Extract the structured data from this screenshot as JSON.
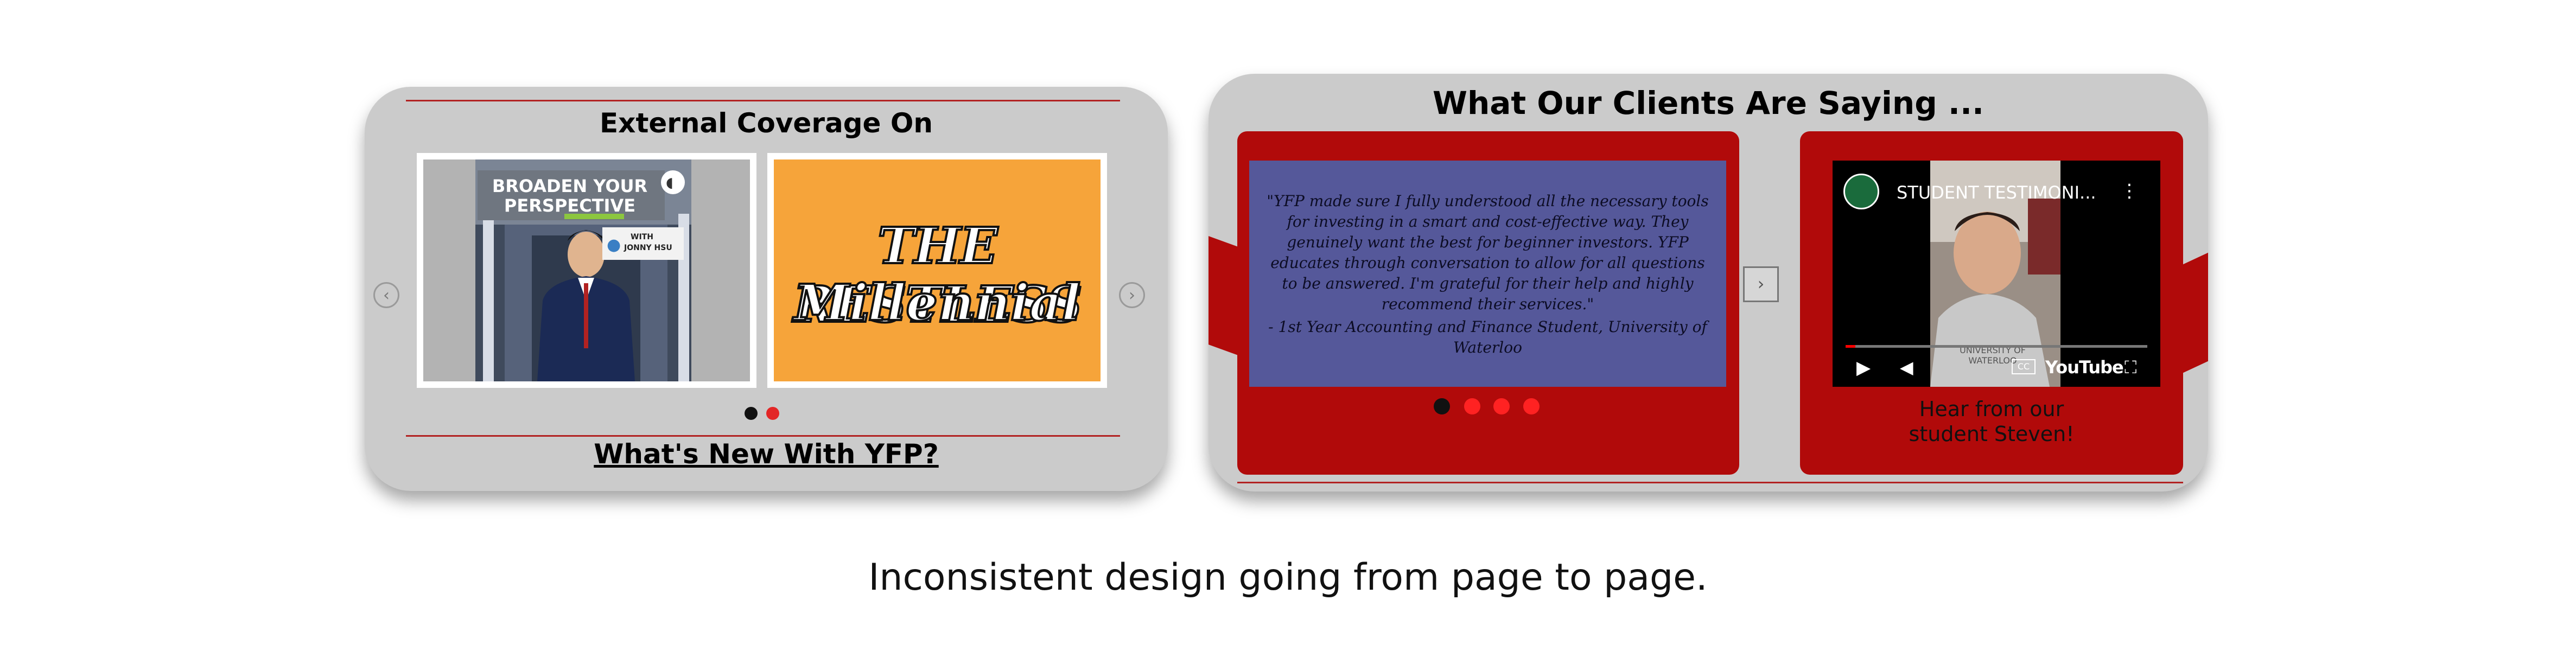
{
  "left_panel": {
    "title": "External Coverage On",
    "link": "What's New With YFP?",
    "thumb1": {
      "line1": "BROADEN YOUR",
      "line2": "PERSPECTIVE",
      "with": "WITH",
      "name": "JONNY HSU"
    },
    "thumb2": {
      "line1": "THE RESTLESS",
      "line2": "Millennial"
    },
    "prev_arrow": "‹",
    "next_arrow": "›"
  },
  "right_panel": {
    "title": "What Our Clients Are Saying ...",
    "quote": "\"YFP made sure I fully understood all the necessary tools for investing in a smart and cost-effective way. They genuinely want the best for beginner investors. YFP educates through conversation to allow for all questions to be answered. I'm grateful for their help and highly recommend their services.\"",
    "attribution": "- 1st Year Accounting and Finance Student, University of Waterloo",
    "next_arrow": "›",
    "video": {
      "title": "STUDENT TESTIMONI...",
      "brand": "YouTube",
      "cc": "CC",
      "shirt": "UNIVERSITY OF WATERLOO"
    },
    "video_caption_line1": "Hear from our",
    "video_caption_line2": "student Steven!"
  },
  "caption": "Inconsistent design going from page to page.",
  "colors": {
    "panel_bg": "#cbcbcb",
    "accent_red": "#b10a0a",
    "quote_bg": "#55589a",
    "orange": "#f6a43a"
  }
}
